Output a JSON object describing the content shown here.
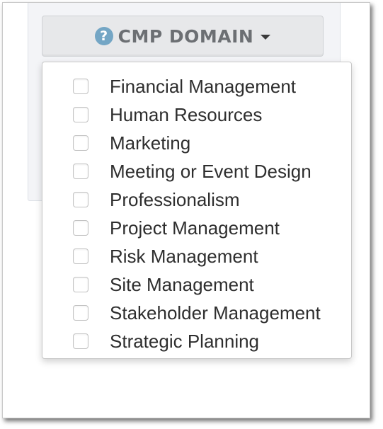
{
  "filter": {
    "button_label": "CMP DOMAIN",
    "help_icon": "question-circle-icon",
    "caret_icon": "caret-down-icon",
    "help_glyph": "?",
    "options": [
      {
        "label": "Financial Management",
        "checked": false
      },
      {
        "label": "Human Resources",
        "checked": false
      },
      {
        "label": "Marketing",
        "checked": false
      },
      {
        "label": "Meeting or Event Design",
        "checked": false
      },
      {
        "label": "Professionalism",
        "checked": false
      },
      {
        "label": "Project Management",
        "checked": false
      },
      {
        "label": "Risk Management",
        "checked": false
      },
      {
        "label": "Site Management",
        "checked": false
      },
      {
        "label": "Stakeholder Management",
        "checked": false
      },
      {
        "label": "Strategic Planning",
        "checked": false
      }
    ]
  },
  "colors": {
    "help_icon_bg": "#74a6c5",
    "button_bg": "#e7e8ea",
    "button_text": "#6c6f73",
    "item_text": "#2e2e2e"
  }
}
